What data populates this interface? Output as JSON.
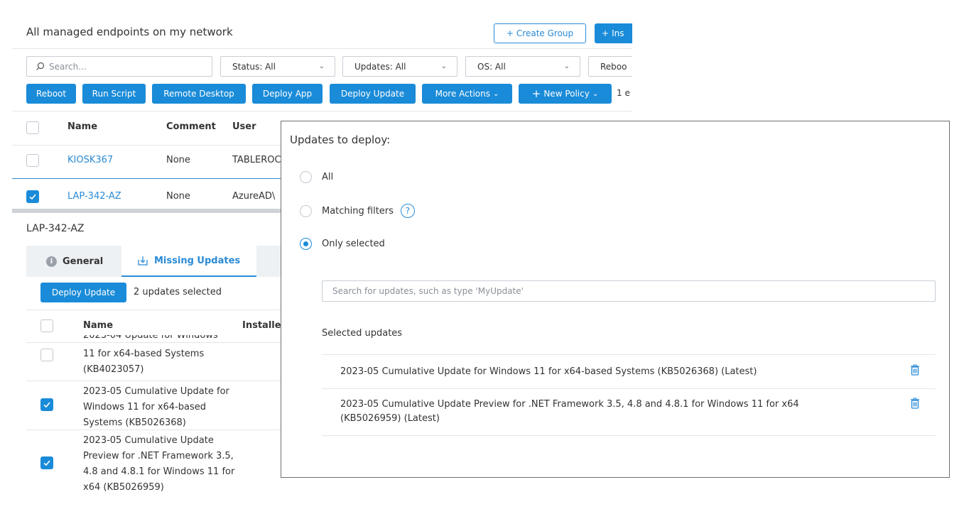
{
  "header": {
    "title": "All managed endpoints on my network",
    "create_group": "Create Group",
    "install": "Ins"
  },
  "filters": {
    "search_placeholder": "Search...",
    "status": "Status: All",
    "updates": "Updates: All",
    "os": "OS: All",
    "reboot": "Reboo"
  },
  "actions": {
    "reboot": "Reboot",
    "run_script": "Run Script",
    "remote_desktop": "Remote Desktop",
    "deploy_app": "Deploy App",
    "deploy_update": "Deploy Update",
    "more_actions": "More Actions",
    "new_policy": "New Policy",
    "tail": "1 e"
  },
  "table": {
    "headers": {
      "name": "Name",
      "comment": "Comment",
      "user": "User"
    },
    "rows": [
      {
        "name": "KIOSK367",
        "comment": "None",
        "user": "TABLEROC",
        "checked": false
      },
      {
        "name": "LAP-342-AZ",
        "comment": "None",
        "user": "AzureAD\\",
        "checked": true
      }
    ]
  },
  "device": {
    "title": "LAP-342-AZ",
    "tabs": {
      "general": "General",
      "missing_updates": "Missing Updates"
    },
    "deploy_update": "Deploy Update",
    "selected_count": "2 updates selected",
    "headers": {
      "name": "Name",
      "installed": "Installe"
    },
    "updates": [
      {
        "name_cut": "2023-04 Update for Windows",
        "name": "11 for x64-based Systems (KB4023057)",
        "checked": false
      },
      {
        "name": "2023-05 Cumulative Update for Windows 11 for x64-based Systems (KB5026368)",
        "checked": true
      },
      {
        "name": "2023-05 Cumulative Update Preview for .NET Framework 3.5, 4.8 and 4.8.1 for Windows 11 for x64 (KB5026959)",
        "checked": true
      }
    ]
  },
  "modal": {
    "title": "Updates to deploy:",
    "options": {
      "all": "All",
      "matching": "Matching filters",
      "help": "?",
      "only_selected": "Only selected"
    },
    "search_placeholder": "Search for updates, such as type 'MyUpdate'",
    "selected_label": "Selected updates",
    "selected_updates": [
      "2023-05 Cumulative Update for Windows 11 for x64-based Systems (KB5026368) (Latest)",
      "2023-05 Cumulative Update Preview for .NET Framework 3.5, 4.8 and 4.8.1 for Windows 11 for x64",
      "(KB5026959) (Latest)"
    ]
  },
  "colors": {
    "accent": "#1a8bd8",
    "link": "#2a8bd6"
  }
}
